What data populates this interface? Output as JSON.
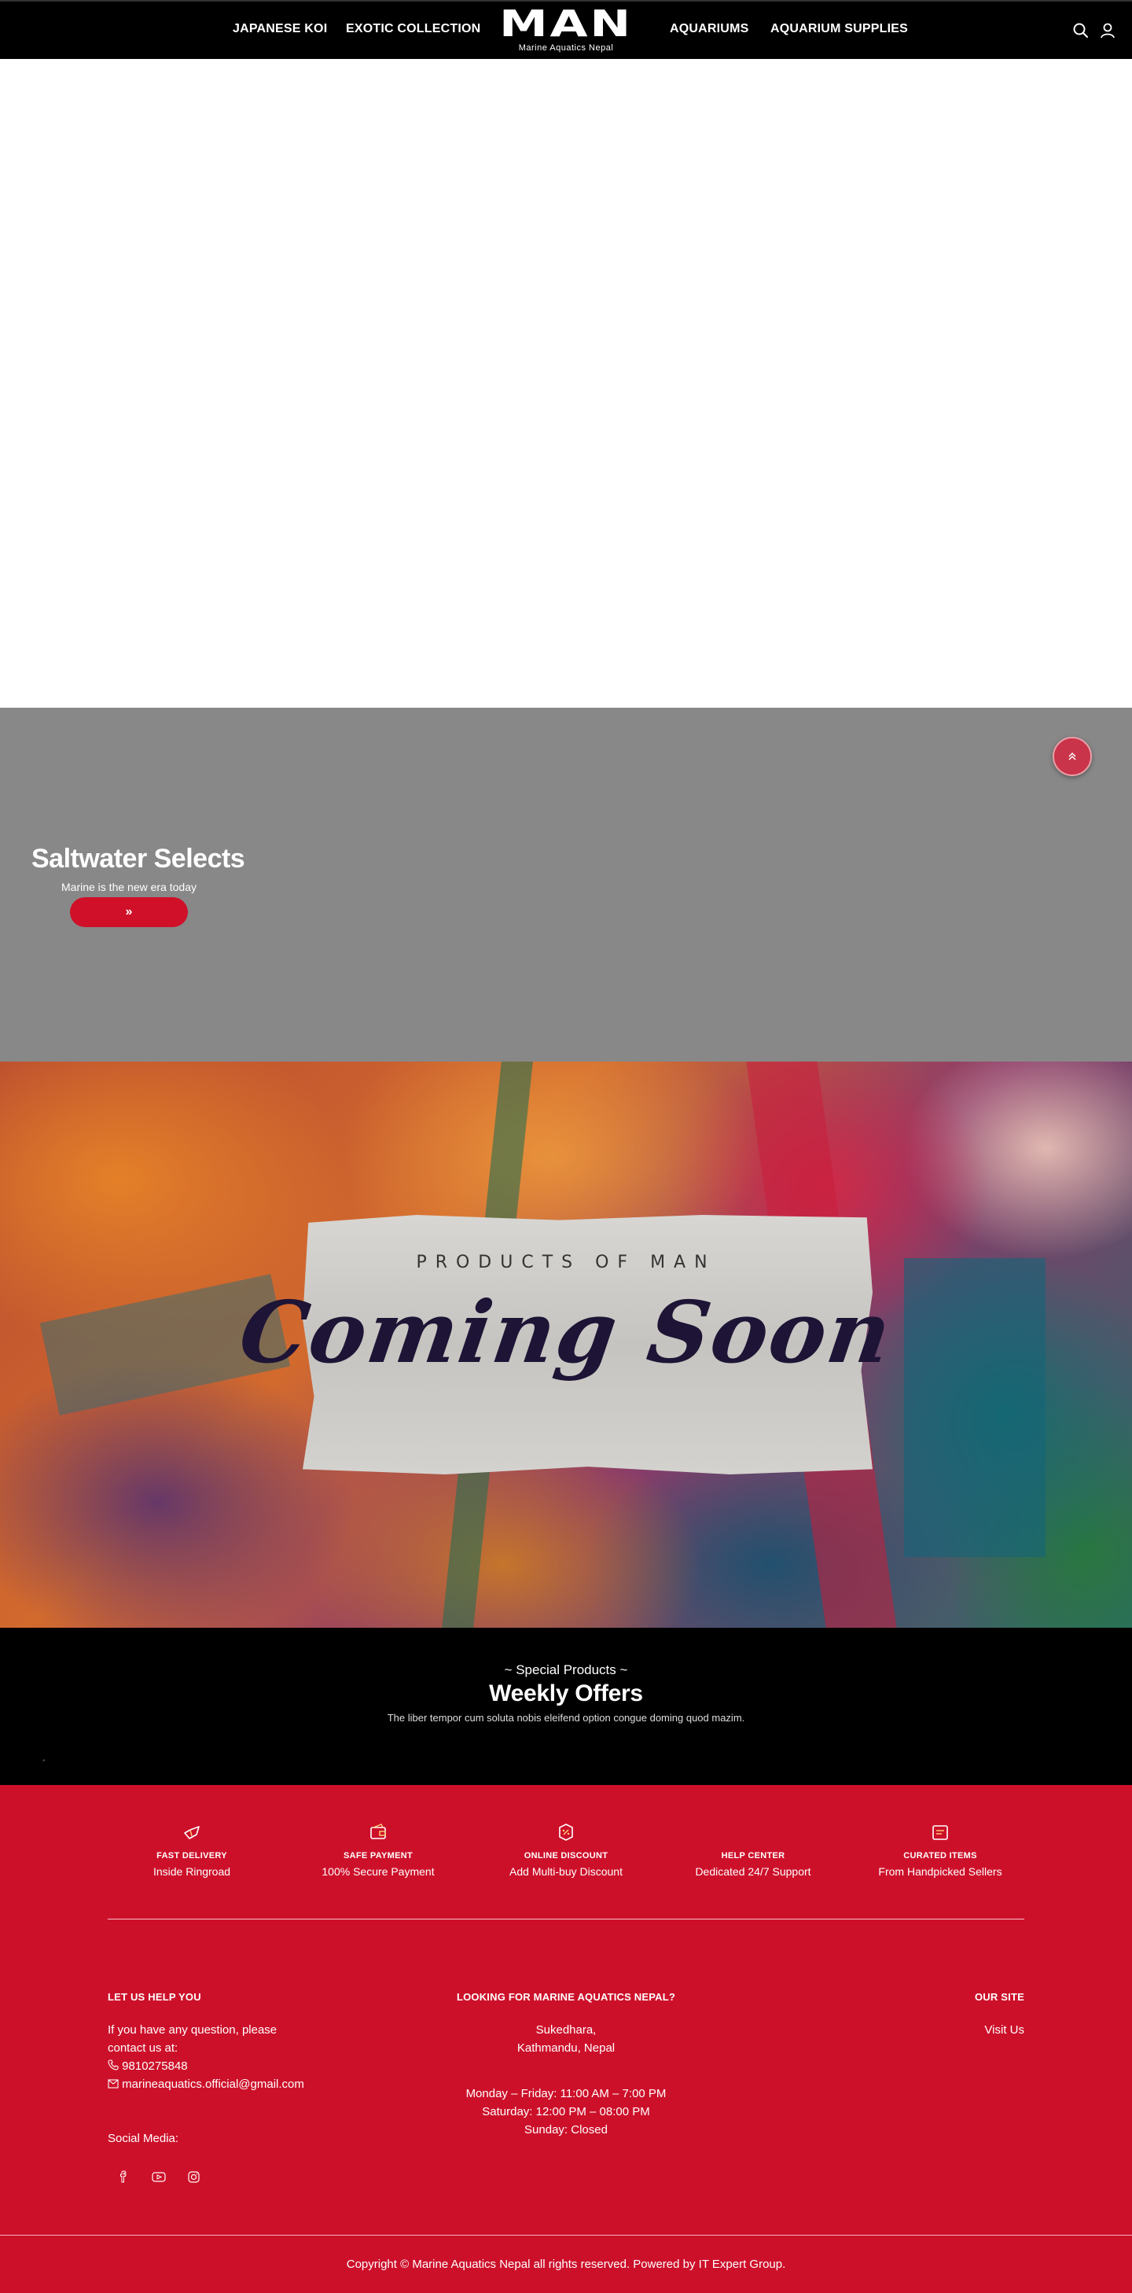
{
  "header": {
    "nav_left": [
      "JAPANESE KOI",
      "EXOTIC COLLECTION"
    ],
    "nav_right": [
      "AQUARIUMS",
      "AQUARIUM SUPPLIES"
    ],
    "logo_mark": "MAN",
    "logo_sub": "Marine Aquatics Nepal",
    "icons": [
      "search-icon",
      "user-icon"
    ]
  },
  "saltwater": {
    "title": "Saltwater Selects",
    "subtitle": "Marine is the new era today",
    "button_label": "»",
    "scroll_top_label": "«"
  },
  "banner": {
    "kicker": "PRODUCTS OF MAN",
    "title": "Coming Soon"
  },
  "offers": {
    "kicker": "~ Special Products ~",
    "title": "Weekly Offers",
    "description": "The liber tempor cum soluta nobis eleifend option congue doming quod mazim.",
    "dot": "•"
  },
  "footer": {
    "features": [
      {
        "icon": "delivery-icon",
        "title": "FAST DELIVERY",
        "subtitle": "Inside Ringroad"
      },
      {
        "icon": "wallet-icon",
        "title": "SAFE PAYMENT",
        "subtitle": "100% Secure Payment"
      },
      {
        "icon": "discount-icon",
        "title": "ONLINE DISCOUNT",
        "subtitle": "Add Multi-buy Discount"
      },
      {
        "icon": "help-icon",
        "title": "HELP CENTER",
        "subtitle": "Dedicated 24/7 Support"
      },
      {
        "icon": "curated-icon",
        "title": "CURATED ITEMS",
        "subtitle": "From Handpicked Sellers"
      }
    ],
    "help": {
      "heading": "LET US HELP YOU",
      "line1": "If you have any question, please",
      "line2": "contact us at:",
      "phone": "9810275848",
      "email": "marineaquatics.official@gmail.com",
      "social_label": "Social Media:",
      "social_icons": [
        "facebook-icon",
        "youtube-icon",
        "instagram-icon"
      ]
    },
    "location": {
      "heading": "LOOKING FOR MARINE AQUATICS NEPAL?",
      "address1": "Sukedhara,",
      "address2": "Kathmandu, Nepal",
      "hours1": "Monday – Friday: 11:00 AM – 7:00 PM",
      "hours2": "Saturday: 12:00 PM – 08:00 PM",
      "hours3": "Sunday: Closed"
    },
    "site": {
      "heading": "OUR SITE",
      "link": "Visit Us"
    },
    "copyright": "Copyright © Marine Aquatics Nepal all rights reserved. Powered by IT Expert Group."
  },
  "colors": {
    "header_bg": "#000000",
    "brand_red": "#cd102a",
    "saltwater_bg": "#888888",
    "offers_bg": "#000000"
  }
}
